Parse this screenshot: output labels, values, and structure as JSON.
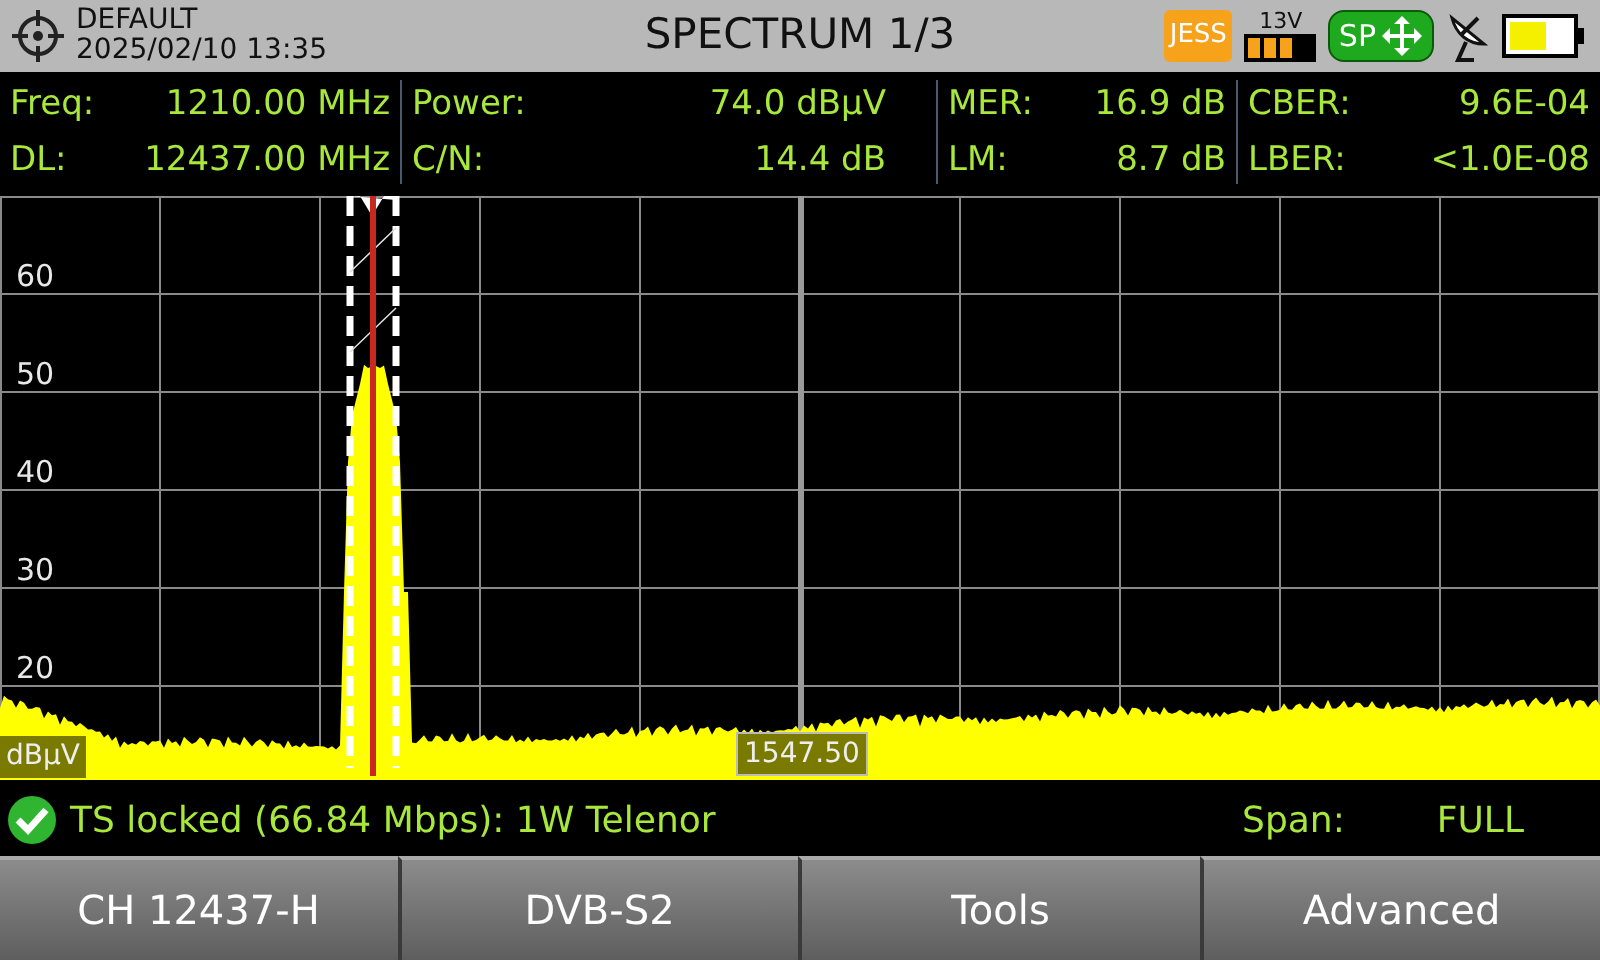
{
  "header": {
    "profile": "DEFAULT",
    "datetime": "2025/02/10 13:35",
    "title": "SPECTRUM 1/3",
    "lnb_badge": "JESS",
    "voltage": "13V",
    "mode_badge": "SP"
  },
  "measurements": [
    [
      {
        "label": "Freq:",
        "value": "1210.00 MHz"
      },
      {
        "label": "DL:",
        "value": "12437.00 MHz"
      }
    ],
    [
      {
        "label": "Power:",
        "value": "74.0 dBµV"
      },
      {
        "label": "C/N:",
        "value": "14.4 dB"
      }
    ],
    [
      {
        "label": "MER:",
        "value": "16.9 dB"
      },
      {
        "label": "LM:",
        "value": "8.7 dB"
      }
    ],
    [
      {
        "label": "CBER:",
        "value": "9.6E-04"
      },
      {
        "label": "LBER:",
        "value": "<1.0E-08"
      }
    ]
  ],
  "spectrum": {
    "y_labels": [
      "60",
      "50",
      "40",
      "30",
      "20"
    ],
    "unit": "dBµV",
    "center_frequency": "1547.50"
  },
  "status": {
    "locked": true,
    "text": "TS locked (66.84 Mbps): 1W Telenor",
    "span_label": "Span:",
    "span_value": "FULL"
  },
  "buttons": [
    "CH 12437-H",
    "DVB-S2",
    "Tools",
    "Advanced"
  ]
}
